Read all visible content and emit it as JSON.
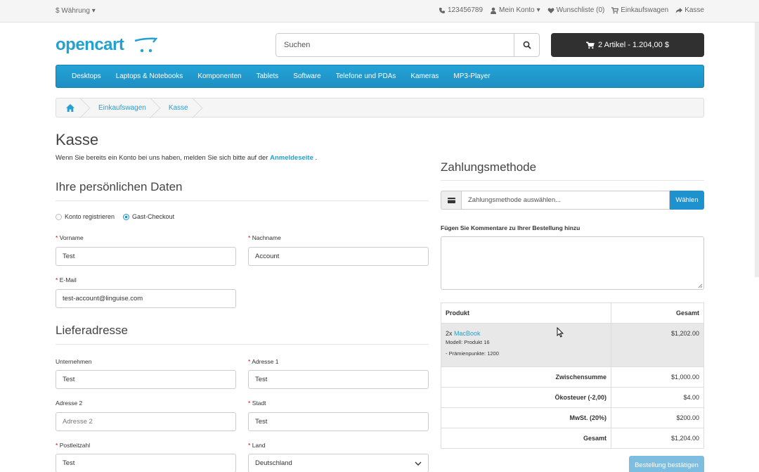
{
  "topbar": {
    "currency": "$ Währung",
    "phone": "123456789",
    "account": "Mein Konto",
    "wishlist": "Wunschliste (0)",
    "cart": "Einkaufswagen",
    "checkout": "Kasse"
  },
  "header": {
    "logo": "opencart",
    "search_placeholder": "Suchen",
    "cart_button": "2 Artikel - 1.204,00 $"
  },
  "menu": [
    "Desktops",
    "Laptops & Notebooks",
    "Komponenten",
    "Tablets",
    "Software",
    "Telefone und PDAs",
    "Kameras",
    "MP3-Player"
  ],
  "breadcrumb": [
    "Einkaufswagen",
    "Kasse"
  ],
  "page": {
    "title": "Kasse",
    "intro_prefix": "Wenn Sie bereits ein Konto bei uns haben, melden Sie sich bitte auf der",
    "intro_link": "Anmeldeseite",
    "intro_suffix": "."
  },
  "personal": {
    "heading": "Ihre persönlichen Daten",
    "radio_register": "Konto registrieren",
    "radio_guest": "Gast-Checkout",
    "firstname_label": "Vorname",
    "firstname": "Test",
    "lastname_label": "Nachname",
    "lastname": "Account",
    "email_label": "E-Mail",
    "email": "test-account@linguise.com"
  },
  "shipping": {
    "heading": "Lieferadresse",
    "company_label": "Unternehmen",
    "company": "Test",
    "address1_label": "Adresse 1",
    "address1": "Test",
    "address2_label": "Adresse 2",
    "address2_placeholder": "Adresse 2",
    "city_label": "Stadt",
    "city": "Test",
    "postcode_label": "Postleitzahl",
    "postcode": "Test",
    "country_label": "Land",
    "country": "Deutschland"
  },
  "payment": {
    "heading": "Zahlungsmethode",
    "placeholder": "Zahlungsmethode auswählen...",
    "choose": "Wählen",
    "comment_label": "Fügen Sie Kommentare zu Ihrer Bestellung hinzu"
  },
  "summary": {
    "col_product": "Produkt",
    "col_total": "Gesamt",
    "qty": "2x",
    "product": "MacBook",
    "model": "Modell: Produkt 16",
    "points": "- Prämienpunkte: 1200",
    "product_total": "$1,202.00",
    "rows": [
      {
        "label": "Zwischensumme",
        "value": "$1,000.00"
      },
      {
        "label": "Ökosteuer (-2,00)",
        "value": "$4.00"
      },
      {
        "label": "MwSt. (20%)",
        "value": "$200.00"
      },
      {
        "label": "Gesamt",
        "value": "$1,204.00"
      }
    ]
  },
  "confirm_button": "Bestellung bestätigen",
  "colors": {
    "accent": "#23a1d1",
    "menu": "#229ac8",
    "dark": "#303030"
  }
}
